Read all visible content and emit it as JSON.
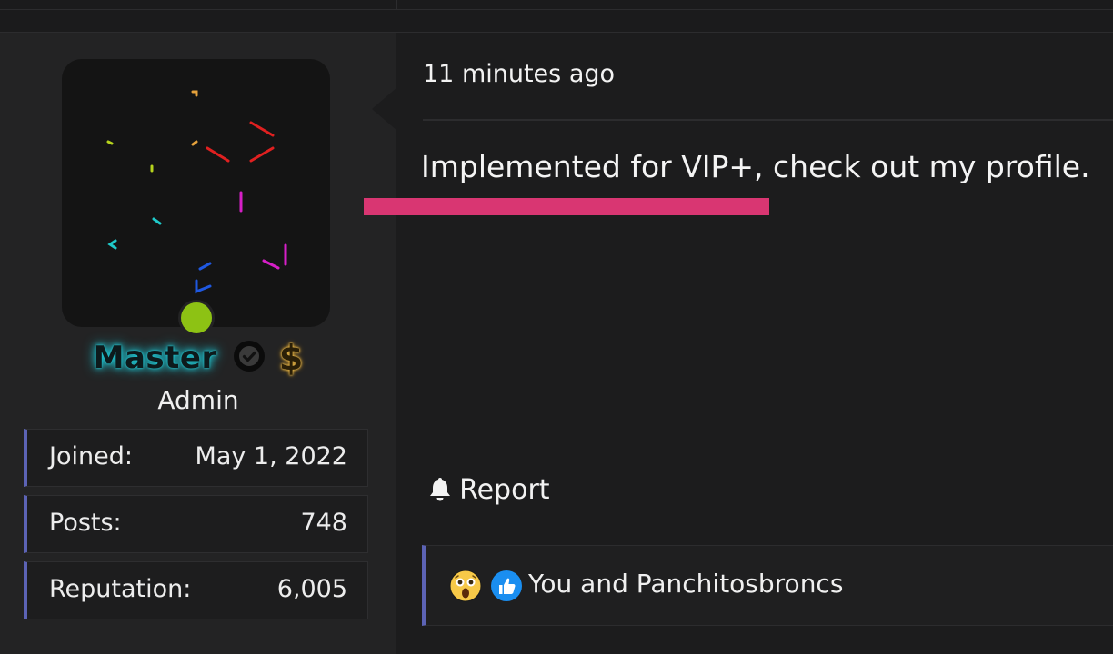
{
  "user": {
    "username": "Master",
    "role": "Admin",
    "status": "online",
    "badges": [
      "verified-check-icon",
      "dollar-icon"
    ],
    "stats": [
      {
        "label": "Joined:",
        "value": "May 1, 2022"
      },
      {
        "label": "Posts:",
        "value": "748"
      },
      {
        "label": "Reputation:",
        "value": "6,005"
      }
    ]
  },
  "post": {
    "timestamp": "11 minutes ago",
    "message": "Implemented for VIP+, check out my profile.",
    "report_label": "Report",
    "reactions": {
      "icons": [
        "astonished-face-icon",
        "thumbs-up-icon"
      ],
      "text": "You and Panchitosbroncs"
    }
  },
  "colors": {
    "accent": "#5c63b5",
    "online": "#8dc214",
    "highlight": "#d93672",
    "username_glow": "#1ec3cf"
  }
}
